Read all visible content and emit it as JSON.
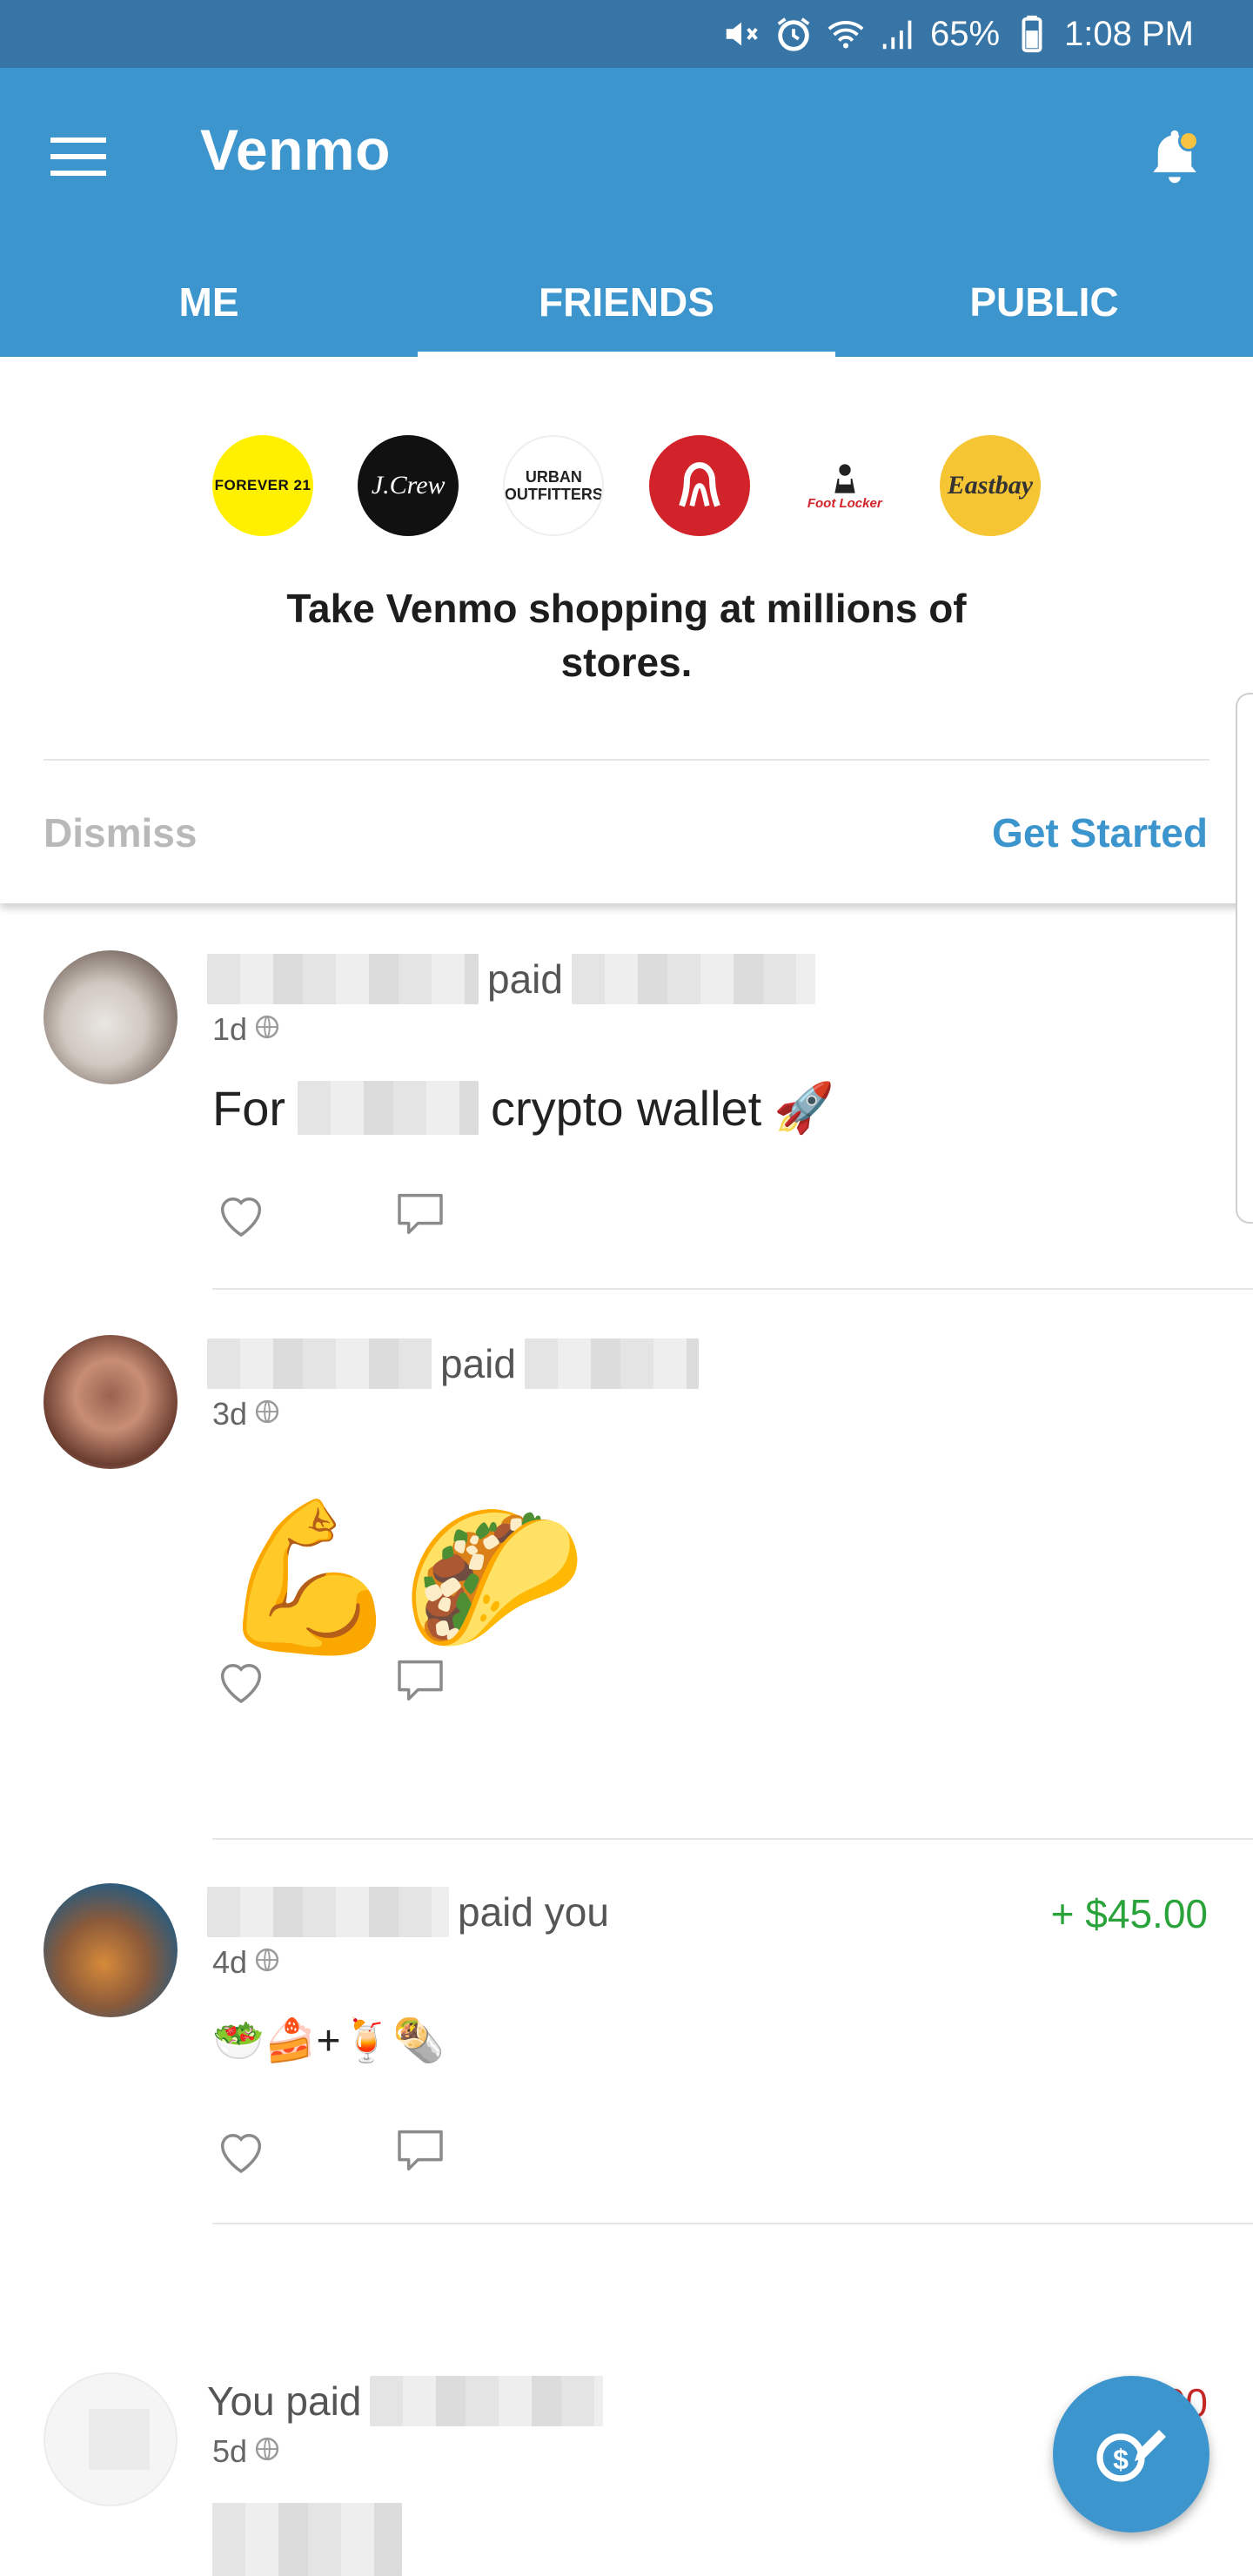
{
  "status_bar": {
    "battery": "65%",
    "time": "1:08 PM",
    "icons": [
      "mute-icon",
      "alarm-icon",
      "wifi-icon",
      "signal-icon",
      "battery-icon"
    ]
  },
  "app_bar": {
    "title": "Venmo",
    "has_notification": true
  },
  "tabs": [
    {
      "label": "ME",
      "active": false
    },
    {
      "label": "FRIENDS",
      "active": true
    },
    {
      "label": "PUBLIC",
      "active": false
    }
  ],
  "promo": {
    "logos": {
      "forever21": "FOREVER 21",
      "jcrew": "J.Crew",
      "urban_line1": "URBAN",
      "urban_line2": "OUTFITTERS",
      "footlocker": "Foot Locker",
      "eastbay": "Eastbay"
    },
    "text": "Take Venmo shopping at millions of stores.",
    "dismiss": "Dismiss",
    "get_started": "Get Started"
  },
  "feed": [
    {
      "action": "paid",
      "time": "1d",
      "note_prefix": "For",
      "note_suffix": "crypto wallet",
      "note_emoji": "🚀",
      "amount": ""
    },
    {
      "action": "paid",
      "time": "3d",
      "note_emoji": "💪🌮",
      "amount": ""
    },
    {
      "action": "paid you",
      "time": "4d",
      "note_emoji": "🥗🍰+🍹🌯",
      "amount": "+ $45.00"
    },
    {
      "action": "You paid",
      "time": "5d",
      "amount": "- $0.00"
    }
  ],
  "colors": {
    "brand": "#3d95ce",
    "status_bar": "#3775a6",
    "positive": "#2aa33b",
    "negative": "#c62828"
  }
}
